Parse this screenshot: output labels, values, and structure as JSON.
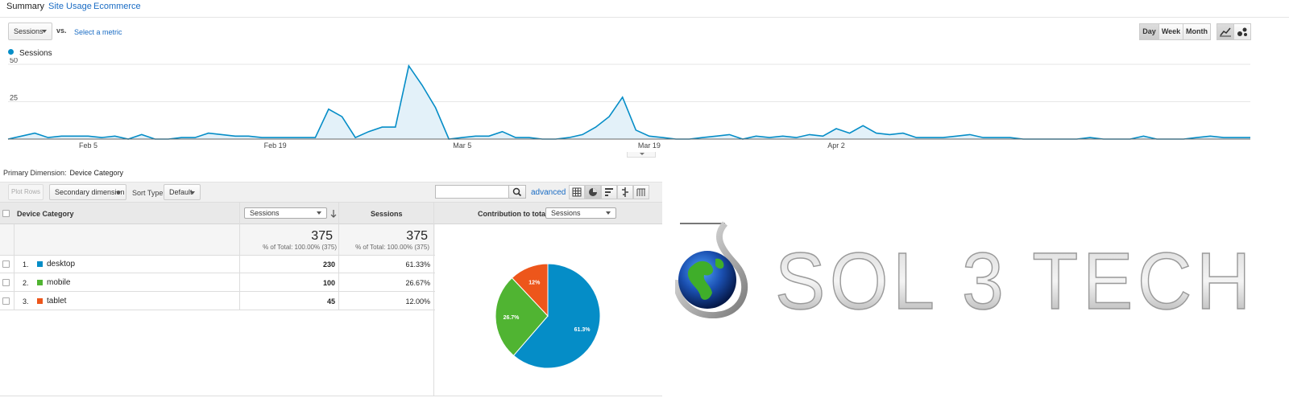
{
  "tabs": [
    {
      "label": "Summary",
      "active": true
    },
    {
      "label": "Site Usage",
      "active": false
    },
    {
      "label": "Ecommerce",
      "active": false
    }
  ],
  "metric_picker": {
    "value": "Sessions",
    "vs_label": "vs.",
    "select_metric": "Select a metric"
  },
  "granularity": {
    "options": [
      "Day",
      "Week",
      "Month"
    ],
    "selected": "Day"
  },
  "chart_view_icons": [
    "line-chart-icon",
    "motion-chart-icon"
  ],
  "chart_data": {
    "type": "area",
    "series": [
      {
        "name": "Sessions",
        "color": "#058dc7",
        "values": [
          0,
          2,
          4,
          1,
          2,
          2,
          2,
          1,
          2,
          0,
          3,
          0,
          0,
          1,
          1,
          4,
          3,
          2,
          2,
          1,
          1,
          1,
          1,
          1,
          20,
          15,
          1,
          5,
          8,
          8,
          49,
          36,
          21,
          0,
          1,
          2,
          2,
          5,
          1,
          1,
          0,
          0,
          1,
          3,
          8,
          15,
          28,
          6,
          2,
          1,
          0,
          0,
          1,
          2,
          3,
          0,
          2,
          1,
          2,
          1,
          3,
          2,
          7,
          4,
          9,
          4,
          3,
          4,
          1,
          1,
          1,
          2,
          3,
          1,
          1,
          1,
          0,
          0,
          0,
          0,
          0,
          1,
          0,
          0,
          0,
          2,
          0,
          0,
          0,
          1,
          2,
          1,
          1,
          1
        ]
      }
    ],
    "x_tick_labels": [
      "Feb 5",
      "Feb 19",
      "Mar 5",
      "Mar 19",
      "Apr 2"
    ],
    "x_tick_index": [
      6,
      20,
      34,
      48,
      62
    ],
    "y_ticks": [
      25,
      50
    ],
    "ylim": [
      0,
      50
    ],
    "grid": true
  },
  "primary_dimension": {
    "label": "Primary Dimension:",
    "value": "Device Category"
  },
  "toolbar": {
    "plot_rows": "Plot Rows",
    "secondary_dimension": "Secondary dimension",
    "sort_type_label": "Sort Type:",
    "sort_type_value": "Default",
    "search_placeholder": "",
    "advanced": "advanced",
    "view_icons": [
      "grid-view-icon",
      "pie-view-icon",
      "performance-view-icon",
      "comparison-view-icon",
      "pivot-view-icon"
    ]
  },
  "table": {
    "dimension_header": "Device Category",
    "metric_select": "Sessions",
    "sessions_header": "Sessions",
    "contribution_label": "Contribution to total:",
    "contribution_select": "Sessions",
    "totals": {
      "value1": "375",
      "pct1": "% of Total: 100.00% (375)",
      "value2": "375",
      "pct2": "% of Total: 100.00% (375)"
    },
    "rows": [
      {
        "num": "1.",
        "name": "desktop",
        "color": "#058dc7",
        "sessions": "230",
        "pct": "61.33%"
      },
      {
        "num": "2.",
        "name": "mobile",
        "color": "#50b432",
        "sessions": "100",
        "pct": "26.67%"
      },
      {
        "num": "3.",
        "name": "tablet",
        "color": "#ed561b",
        "sessions": "45",
        "pct": "12.00%"
      }
    ]
  },
  "pie": {
    "slices": [
      {
        "label": "61.3%",
        "value": 61.33,
        "color": "#058dc7"
      },
      {
        "label": "26.7%",
        "value": 26.67,
        "color": "#50b432"
      },
      {
        "label": "12%",
        "value": 12.0,
        "color": "#ed561b"
      }
    ]
  },
  "logo": {
    "text": "SOL 3 TECH"
  }
}
